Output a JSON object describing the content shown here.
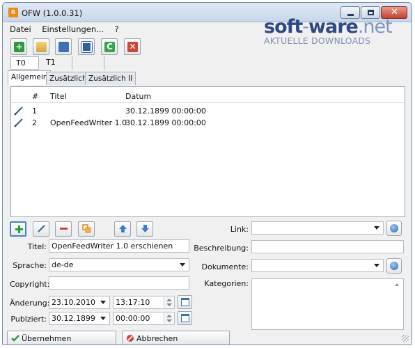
{
  "window": {
    "title": "OFW (1.0.0.31)"
  },
  "watermark": {
    "brand_main": "soft",
    "brand_dash": "-",
    "brand_mid": "ware",
    "brand_tld": ".net",
    "tagline": "AKTUELLE DOWNLOADS"
  },
  "menu": [
    "Datei",
    "Einstellungen...",
    "?"
  ],
  "toolbar": {
    "icons": [
      "add-icon",
      "open-folder-icon",
      "copy-icon",
      "save-icon",
      "refresh-icon",
      "delete-icon"
    ]
  },
  "feed_tabs": [
    "T0",
    "T1"
  ],
  "main_tabs": [
    "Allgemein",
    "Zusätzlich",
    "Zusätzlich II"
  ],
  "list": {
    "columns": [
      "#",
      "Titel",
      "Datum"
    ],
    "rows": [
      {
        "num": "1",
        "title": "",
        "date": "30.12.1899 00:00:00"
      },
      {
        "num": "2",
        "title": "OpenFeedWriter 1.0",
        "date": "30.12.1899 00:00:00"
      }
    ]
  },
  "form": {
    "titel_label": "Titel:",
    "titel_value": "OpenFeedWriter 1.0 erschienen",
    "sprache_label": "Sprache:",
    "sprache_value": "de-de",
    "copyright_label": "Copyright:",
    "copyright_value": "",
    "aenderung_label": "Änderung:",
    "aenderung_date": "23.10.2010",
    "aenderung_time": "13:17:10",
    "publiziert_label": "Publziert:",
    "publiziert_date": "30.12.1899",
    "publiziert_time": "00:00:00",
    "link_label": "Link:",
    "link_value": "",
    "beschreibung_label": "Beschreibung:",
    "beschreibung_value": "",
    "dokumente_label": "Dokumente:",
    "dokumente_value": "",
    "kategorien_label": "Kategorien:"
  },
  "buttons": {
    "apply": "Übernehmen",
    "cancel": "Abbrechen"
  }
}
